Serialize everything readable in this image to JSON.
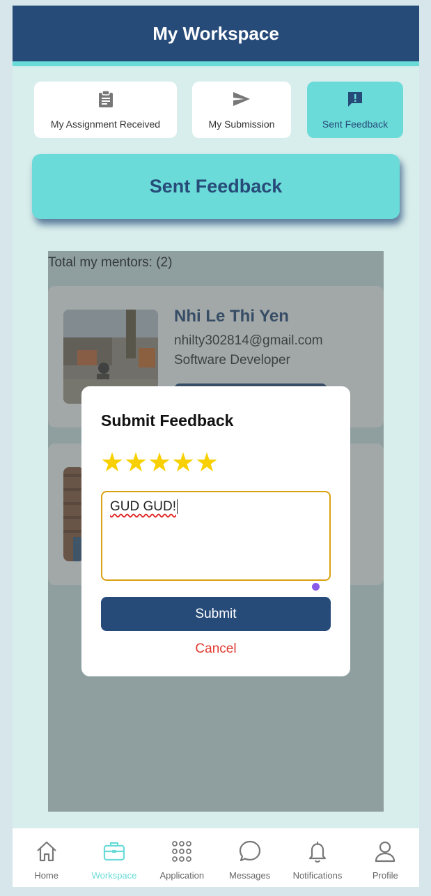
{
  "header": {
    "title": "My Workspace"
  },
  "tabs": [
    {
      "label": "My Assignment Received",
      "icon": "clipboard-icon",
      "active": false
    },
    {
      "label": "My Submission",
      "icon": "send-icon",
      "active": false
    },
    {
      "label": "Sent Feedback",
      "icon": "feedback-icon",
      "active": true
    }
  ],
  "banner": {
    "title": "Sent Feedback"
  },
  "list": {
    "total_label": "Total my mentors: (2)",
    "mentors": [
      {
        "name": "Nhi Le Thi Yen",
        "email": "nhilty302814@gmail.com",
        "role": "Software Developer"
      }
    ]
  },
  "modal": {
    "title": "Submit Feedback",
    "rating": 5,
    "max_rating": 5,
    "feedback_value": "GUD GUD!",
    "submit_label": "Submit",
    "cancel_label": "Cancel"
  },
  "bottom_nav": [
    {
      "label": "Home",
      "icon": "home-icon",
      "active": false
    },
    {
      "label": "Workspace",
      "icon": "briefcase-icon",
      "active": true
    },
    {
      "label": "Application",
      "icon": "grid-dots-icon",
      "active": false
    },
    {
      "label": "Messages",
      "icon": "chat-icon",
      "active": false
    },
    {
      "label": "Notifications",
      "icon": "bell-icon",
      "active": false
    },
    {
      "label": "Profile",
      "icon": "user-icon",
      "active": false
    }
  ],
  "colors": {
    "primary": "#274b79",
    "accent": "#6adbd8",
    "star": "#f8d000",
    "cancel": "#e0392e"
  }
}
